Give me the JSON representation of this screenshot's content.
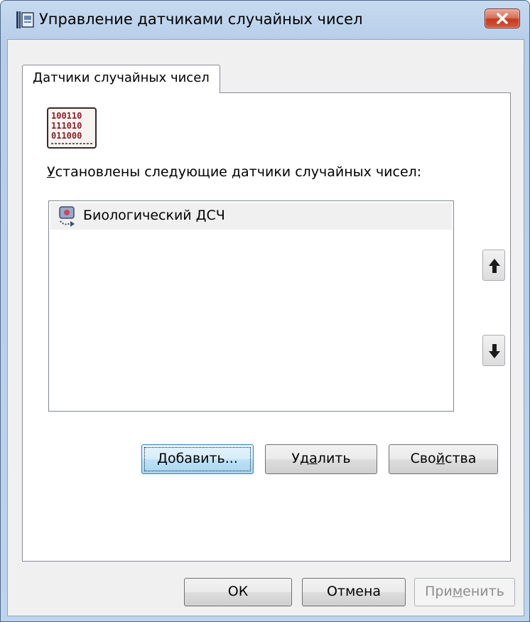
{
  "window": {
    "title": "Управление датчиками случайных чисел"
  },
  "tabs": [
    {
      "label": "Датчики случайных чисел"
    }
  ],
  "panel": {
    "installed_label_mnemonic": "У",
    "installed_label_rest": "становлены следующие датчики случайных чисел:"
  },
  "rng_list": {
    "items": [
      {
        "label": "Биологический ДСЧ",
        "icon": "rng-device-icon",
        "selected": true
      }
    ]
  },
  "list_buttons": {
    "move_up_icon": "arrow-up-icon",
    "move_down_icon": "arrow-down-icon"
  },
  "actions": {
    "add_mnemonic": "Д",
    "add_rest": "обавить...",
    "remove_pre": "Уд",
    "remove_mnemonic": "а",
    "remove_post": "лить",
    "properties_pre": "Сво",
    "properties_mnemonic": "й",
    "properties_post": "ства"
  },
  "dialog_buttons": {
    "ok": "ОК",
    "cancel": "Отмена",
    "apply_pre": "При",
    "apply_mnemonic": "м",
    "apply_post": "енить"
  },
  "colors": {
    "titlebar": "#bed3ec",
    "close_button": "#c43a1f",
    "panel_bg": "#ffffff",
    "dialog_bg": "#f0f0f0",
    "default_button_border": "#3c7fb1"
  }
}
